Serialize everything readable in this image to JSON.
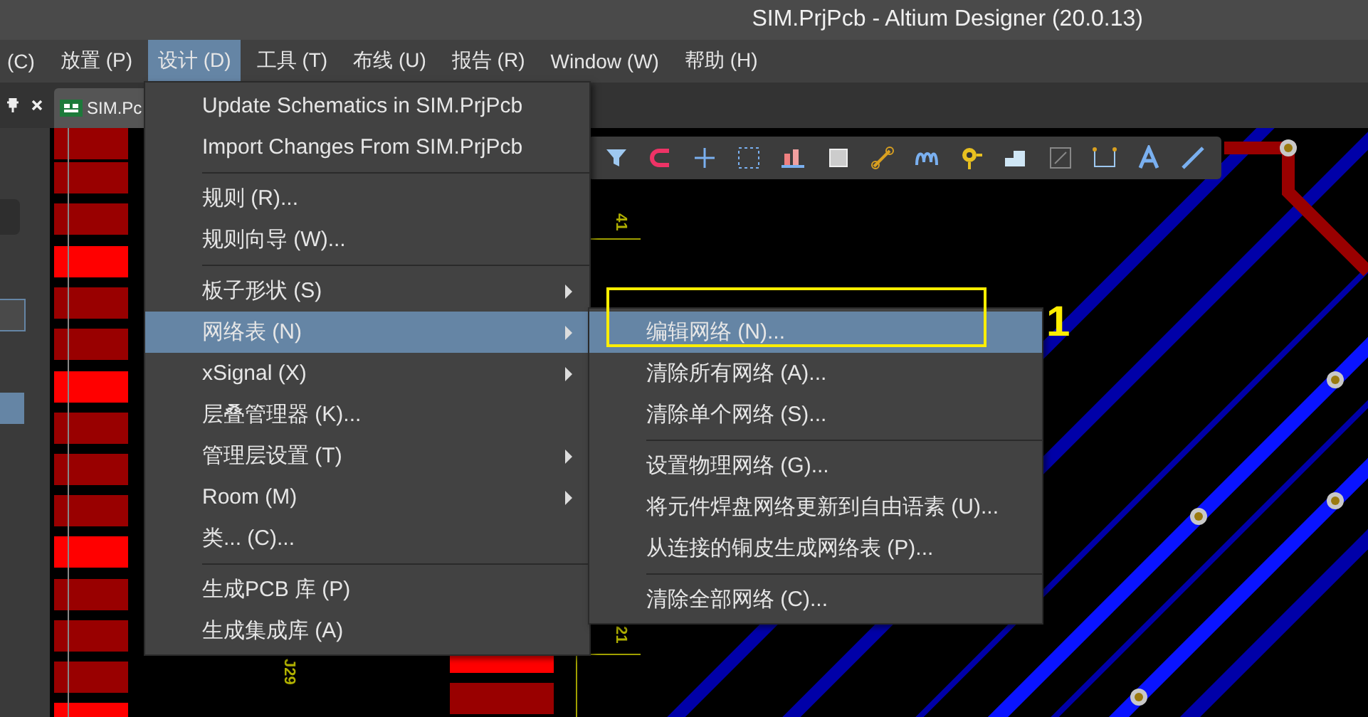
{
  "window": {
    "title": "SIM.PrjPcb - Altium Designer (20.0.13)"
  },
  "menu_bar": [
    {
      "label": "(C)",
      "selected": false
    },
    {
      "label": "放置 (P)",
      "selected": false
    },
    {
      "label": "设计 (D)",
      "selected": true
    },
    {
      "label": "工具 (T)",
      "selected": false
    },
    {
      "label": "布线 (U)",
      "selected": false
    },
    {
      "label": "报告 (R)",
      "selected": false
    },
    {
      "label": "Window (W)",
      "selected": false
    },
    {
      "label": "帮助 (H)",
      "selected": false
    }
  ],
  "document_tab": {
    "label": "SIM.Pc"
  },
  "design_menu": [
    {
      "kind": "item",
      "label": "Update Schematics in SIM.PrjPcb",
      "submenu": false,
      "selected": false
    },
    {
      "kind": "item",
      "label": "Import Changes From SIM.PrjPcb",
      "submenu": false,
      "selected": false
    },
    {
      "kind": "separator"
    },
    {
      "kind": "item",
      "label": "规则 (R)...",
      "submenu": false,
      "selected": false
    },
    {
      "kind": "item",
      "label": "规则向导 (W)...",
      "submenu": false,
      "selected": false
    },
    {
      "kind": "separator"
    },
    {
      "kind": "item",
      "label": "板子形状 (S)",
      "submenu": true,
      "selected": false
    },
    {
      "kind": "item",
      "label": "网络表 (N)",
      "submenu": true,
      "selected": true
    },
    {
      "kind": "item",
      "label": "xSignal (X)",
      "submenu": true,
      "selected": false
    },
    {
      "kind": "item",
      "label": "层叠管理器 (K)...",
      "submenu": false,
      "selected": false
    },
    {
      "kind": "item",
      "label": "管理层设置 (T)",
      "submenu": true,
      "selected": false
    },
    {
      "kind": "item",
      "label": "Room (M)",
      "submenu": true,
      "selected": false
    },
    {
      "kind": "item",
      "label": "类... (C)...",
      "submenu": false,
      "selected": false
    },
    {
      "kind": "separator"
    },
    {
      "kind": "item",
      "label": "生成PCB 库 (P)",
      "submenu": false,
      "selected": false
    },
    {
      "kind": "item",
      "label": "生成集成库 (A)",
      "submenu": false,
      "selected": false
    }
  ],
  "netlist_submenu": [
    {
      "kind": "item",
      "label": "编辑网络 (N)...",
      "selected": true
    },
    {
      "kind": "item",
      "label": "清除所有网络 (A)...",
      "selected": false
    },
    {
      "kind": "item",
      "label": "清除单个网络 (S)...",
      "selected": false
    },
    {
      "kind": "separator"
    },
    {
      "kind": "item",
      "label": "设置物理网络 (G)...",
      "selected": false
    },
    {
      "kind": "item",
      "label": "将元件焊盘网络更新到自由语素 (U)...",
      "selected": false
    },
    {
      "kind": "item",
      "label": "从连接的铜皮生成网络表 (P)...",
      "selected": false
    },
    {
      "kind": "separator"
    },
    {
      "kind": "item",
      "label": "清除全部网络 (C)...",
      "selected": false
    }
  ],
  "annotation": {
    "label": "1"
  },
  "designators": [
    "41",
    "21",
    "J29"
  ]
}
